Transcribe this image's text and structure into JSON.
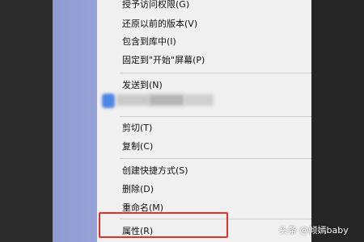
{
  "menu": {
    "items_top": [
      {
        "label": "授予访问权限(G)"
      },
      {
        "label": "还原以前的版本(V)"
      },
      {
        "label": "包含到库中(I)"
      },
      {
        "label": "固定到\"开始\"屏幕(P)"
      }
    ],
    "send_to": {
      "label": "发送到(N)"
    },
    "items_clipboard": [
      {
        "label": "剪切(T)"
      },
      {
        "label": "复制(C)"
      }
    ],
    "items_manage": [
      {
        "label": "创建快捷方式(S)"
      },
      {
        "label": "删除(D)"
      },
      {
        "label": "重命名(M)"
      }
    ],
    "properties": {
      "label": "属性(R)"
    }
  },
  "watermark": {
    "text": "头条 @倾嫣baby"
  },
  "colors": {
    "highlight": "#e0302a",
    "sidebar": "#8e9ad2",
    "menu_bg": "#f0f0f0"
  }
}
